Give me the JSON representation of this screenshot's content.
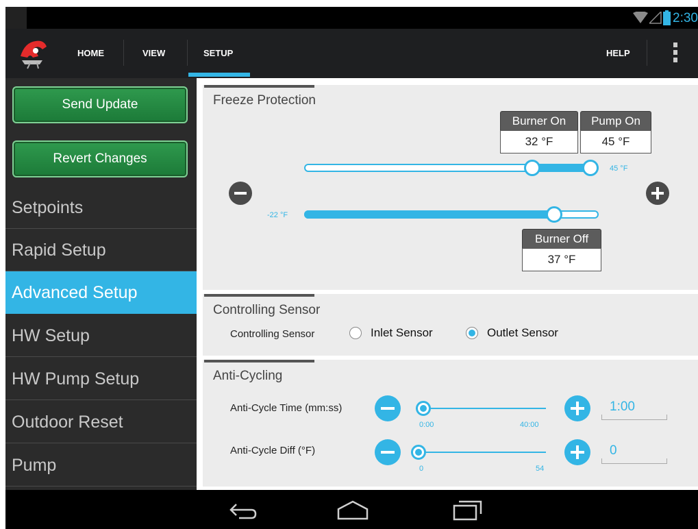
{
  "status_bar": {
    "time": "2:30"
  },
  "app_bar": {
    "logo": "horse-logo",
    "tabs": [
      {
        "label": "HOME"
      },
      {
        "label": "VIEW"
      },
      {
        "label": "SETUP"
      }
    ],
    "active_tab": "SETUP",
    "help_label": "HELP",
    "overflow_icon": "more-vertical-icon"
  },
  "sidebar": {
    "send_update_label": "Send Update",
    "revert_changes_label": "Revert Changes",
    "items": [
      {
        "label": "Setpoints"
      },
      {
        "label": "Rapid Setup"
      },
      {
        "label": "Advanced Setup"
      },
      {
        "label": "HW Setup"
      },
      {
        "label": "HW Pump Setup"
      },
      {
        "label": "Outdoor Reset"
      },
      {
        "label": "Pump"
      }
    ],
    "active_item": "Advanced Setup"
  },
  "freeze_protection": {
    "title": "Freeze Protection",
    "burner_on": {
      "label": "Burner On",
      "value": "32 °F"
    },
    "pump_on": {
      "label": "Pump On",
      "value": "45 °F"
    },
    "burner_off": {
      "label": "Burner Off",
      "value": "37 °F"
    },
    "upper_slider_max_label": "45 °F",
    "lower_slider_min_label": "-22 °F",
    "upper_slider": {
      "low_fraction": 0.79,
      "high_fraction": 1.0
    },
    "lower_slider": {
      "fraction": 0.87
    },
    "minus_icon": "minus-circle-icon",
    "plus_icon": "plus-circle-icon"
  },
  "controlling_sensor": {
    "title": "Controlling Sensor",
    "field_label": "Controlling Sensor",
    "options": [
      {
        "label": "Inlet Sensor",
        "selected": false
      },
      {
        "label": "Outlet Sensor",
        "selected": true
      }
    ]
  },
  "anti_cycling": {
    "title": "Anti-Cycling",
    "time": {
      "label": "Anti-Cycle Time (mm:ss)",
      "min_label": "0:00",
      "max_label": "40:00",
      "value": "1:00",
      "fraction": 0.0
    },
    "diff": {
      "label": "Anti-Cycle Diff (°F)",
      "min_label": "0",
      "max_label": "54",
      "value": "0",
      "fraction": 0.0
    }
  },
  "nav_bar": {
    "back_icon": "back-icon",
    "home_icon": "home-icon",
    "recents_icon": "recents-icon"
  },
  "colors": {
    "accent": "#33b5e5",
    "button_green": "#2f9a4e",
    "sidebar_bg": "#2b2b2b",
    "section_bg": "#ececec"
  }
}
